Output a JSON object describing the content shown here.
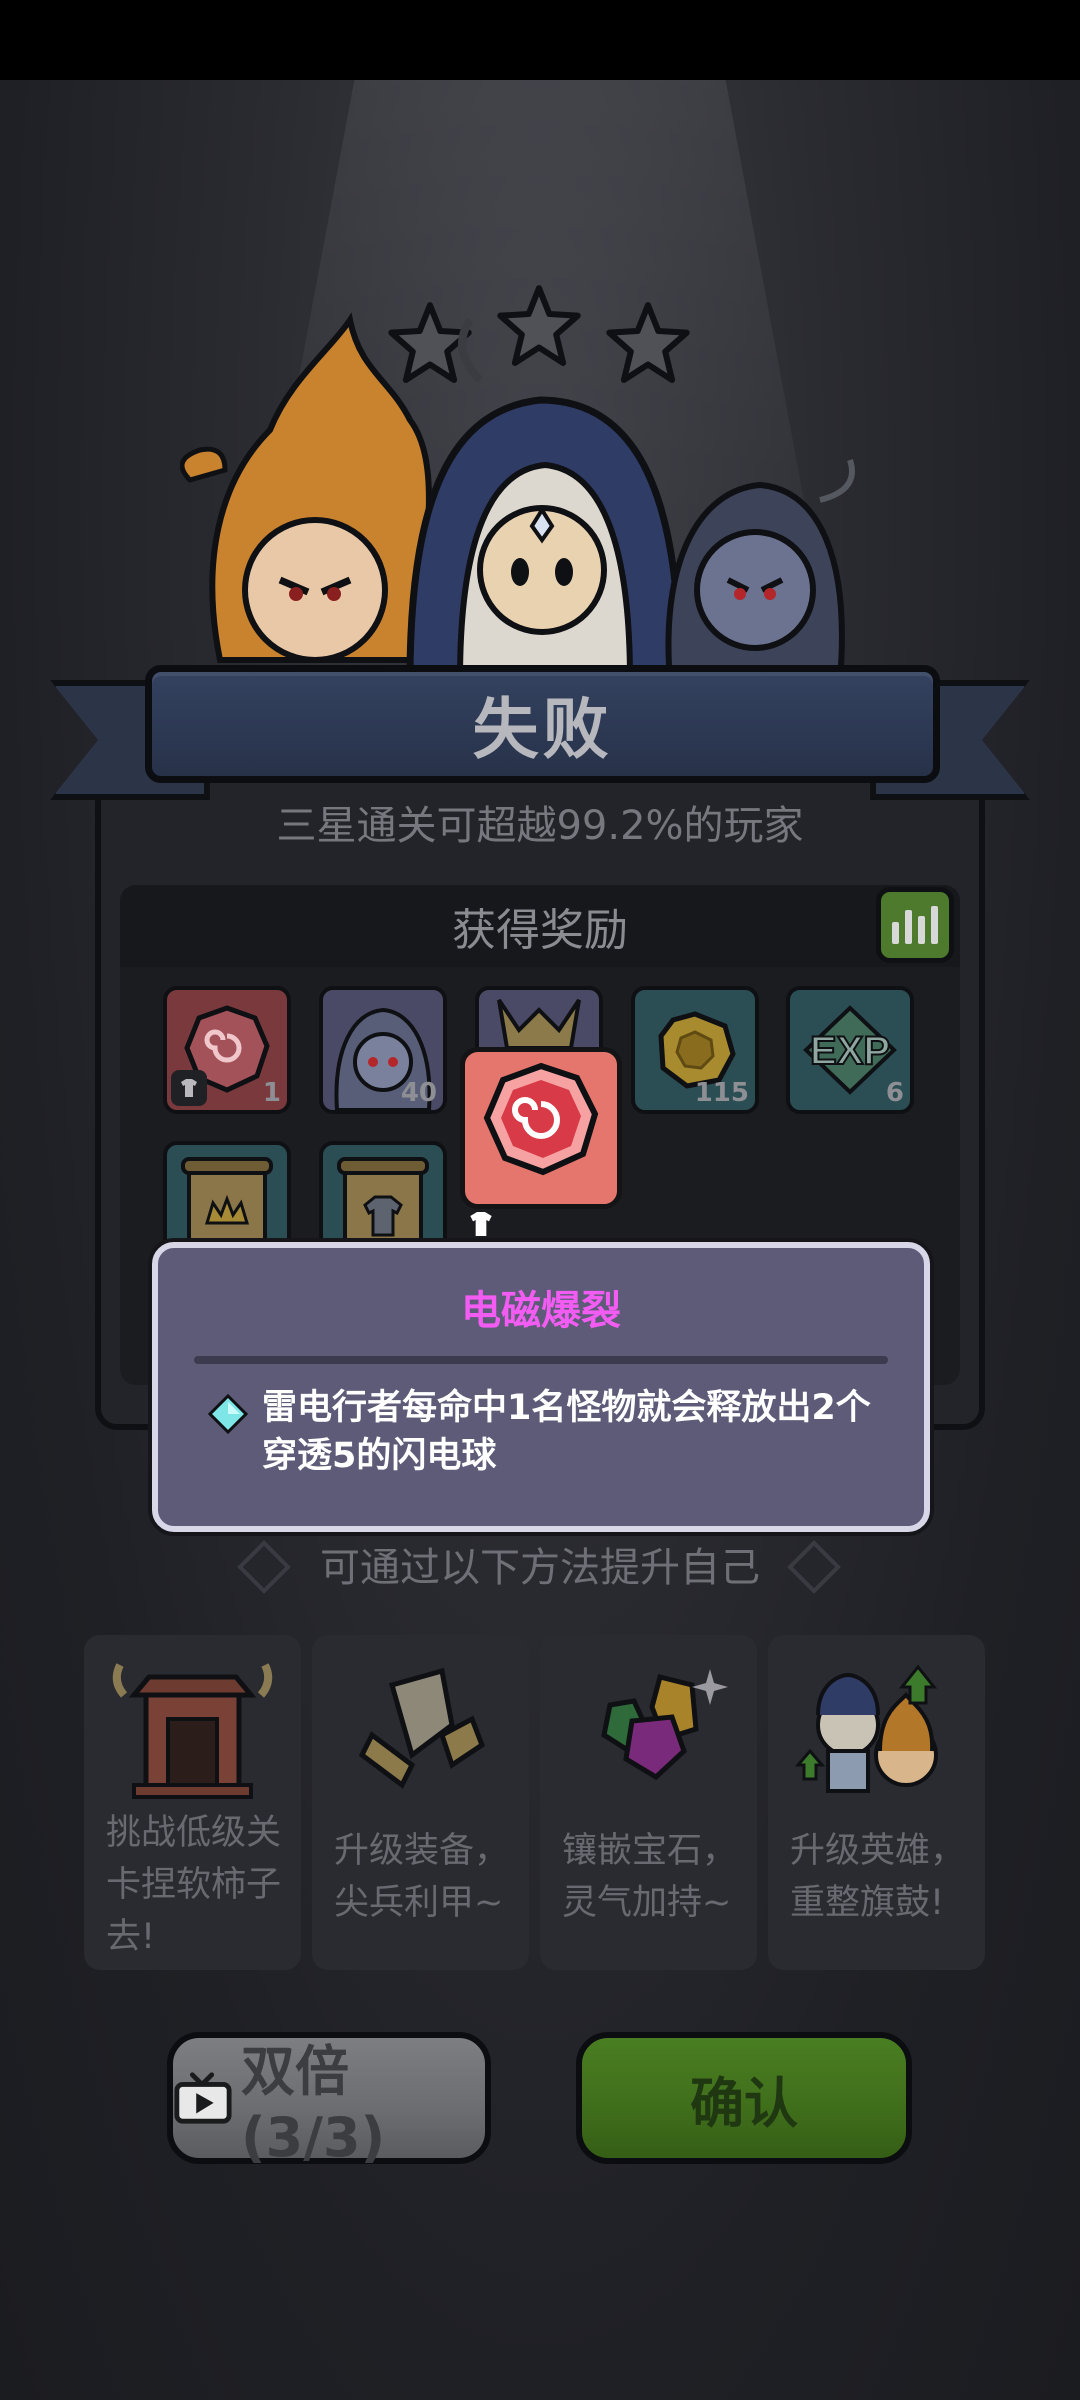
{
  "result": {
    "title": "失败",
    "subtitle": "三星通关可超越99.2%的玩家",
    "stars_earned": 0,
    "stars_total": 3
  },
  "rewards": {
    "title": "获得奖励",
    "items": [
      {
        "icon": "red-gem-icon",
        "count": "1"
      },
      {
        "icon": "hero-portrait-icon",
        "count": "40"
      },
      {
        "icon": "horned-helmet-icon",
        "count": ""
      },
      {
        "icon": "gold-coin-icon",
        "count": "115"
      },
      {
        "icon": "exp-icon",
        "count": "6"
      },
      {
        "icon": "crown-scroll-icon",
        "count": ""
      },
      {
        "icon": "armor-scroll-icon",
        "count": ""
      }
    ]
  },
  "tooltip": {
    "title": "电磁爆裂",
    "description": "雷电行者每命中1名怪物就会释放出2个穿透5的闪电球"
  },
  "tips": {
    "header": "可通过以下方法提升自己",
    "cards": [
      {
        "icon": "gate-icon",
        "text": "挑战低级关卡捏软柿子去!"
      },
      {
        "icon": "equipment-icon",
        "text": "升级装备，尖兵利甲~"
      },
      {
        "icon": "gems-icon",
        "text": "镶嵌宝石，灵气加持~"
      },
      {
        "icon": "heroes-upgrade-icon",
        "text": "升级英雄，重整旗鼓!"
      }
    ]
  },
  "buttons": {
    "double": "双倍(3/3)",
    "confirm": "确认"
  },
  "colors": {
    "tooltip_title": "#f25cf2",
    "confirm_green": "#4a7e22",
    "banner_blue": "#344260"
  }
}
